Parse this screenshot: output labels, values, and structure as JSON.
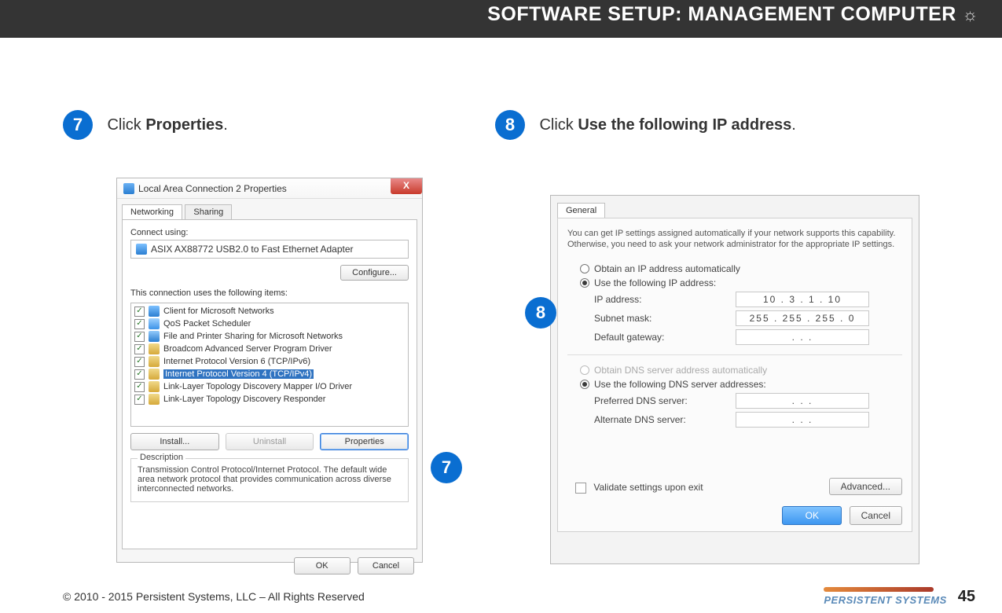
{
  "header": {
    "title": "SOFTWARE SETUP:  MANAGEMENT COMPUTER",
    "decor": "☼"
  },
  "steps": {
    "s7": {
      "num": "7",
      "pre": "Click ",
      "bold": "Properties",
      "post": "."
    },
    "s8": {
      "num": "8",
      "pre": "Click ",
      "bold": "Use the following IP address",
      "post": "."
    }
  },
  "callouts": {
    "c7": "7",
    "c8": "8"
  },
  "dialog7": {
    "title": "Local Area Connection 2 Properties",
    "close": "X",
    "tabs": {
      "networking": "Networking",
      "sharing": "Sharing"
    },
    "connectUsingLabel": "Connect using:",
    "adapter": "ASIX AX88772 USB2.0 to Fast Ethernet Adapter",
    "configure": "Configure...",
    "itemsLabel": "This connection uses the following items:",
    "items": [
      "Client for Microsoft Networks",
      "QoS Packet Scheduler",
      "File and Printer Sharing for Microsoft Networks",
      "Broadcom Advanced Server Program Driver",
      "Internet Protocol Version 6 (TCP/IPv6)",
      "Internet Protocol Version 4 (TCP/IPv4)",
      "Link-Layer Topology Discovery Mapper I/O Driver",
      "Link-Layer Topology Discovery Responder"
    ],
    "install": "Install...",
    "uninstall": "Uninstall",
    "properties": "Properties",
    "descLegend": "Description",
    "descText": "Transmission Control Protocol/Internet Protocol. The default wide area network protocol that provides communication across diverse interconnected networks.",
    "ok": "OK",
    "cancel": "Cancel"
  },
  "dialog8": {
    "tab": "General",
    "intro": "You can get IP settings assigned automatically if your network supports this capability. Otherwise, you need to ask your network administrator for the appropriate IP settings.",
    "r_auto": "Obtain an IP address automatically",
    "r_manual": "Use the following IP address:",
    "ip_label": "IP address:",
    "ip_val": "10  .  3  .  1  .  10",
    "mask_label": "Subnet mask:",
    "mask_val": "255 . 255 . 255 .  0",
    "gw_label": "Default gateway:",
    "gw_val": ".      .      .",
    "dns_auto": "Obtain DNS server address automatically",
    "dns_manual": "Use the following DNS server addresses:",
    "pdns_label": "Preferred DNS server:",
    "pdns_val": ".      .      .",
    "adns_label": "Alternate DNS server:",
    "adns_val": ".      .      .",
    "validate": "Validate settings upon exit",
    "advanced": "Advanced...",
    "ok": "OK",
    "cancel": "Cancel"
  },
  "footer": {
    "copyright": "© 2010 - 2015 Persistent Systems, LLC – All Rights Reserved",
    "brand": "PERSISTENT SYSTEMS",
    "page": "45"
  }
}
